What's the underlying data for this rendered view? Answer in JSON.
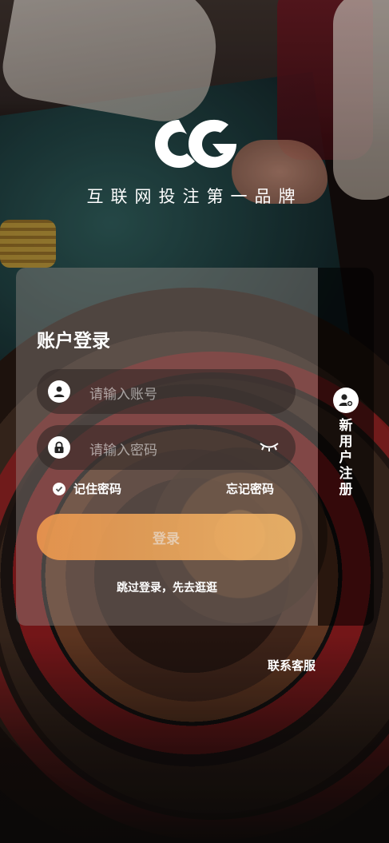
{
  "brand": {
    "logo_text": "CG",
    "tagline": "互联网投注第一品牌"
  },
  "login": {
    "title": "账户登录",
    "username_placeholder": "请输入账号",
    "password_placeholder": "请输入密码",
    "remember_label": "记住密码",
    "forgot_label": "忘记密码",
    "login_button": "登录",
    "skip_link": "跳过登录，先去逛逛"
  },
  "register": {
    "label": "新用户注册"
  },
  "footer": {
    "customer_service": "联系客服"
  },
  "colors": {
    "accent": "#f3a35a",
    "panel": "rgba(150,140,136,0.42)",
    "side": "rgba(0,0,0,0.55)"
  },
  "icons": [
    "user-icon",
    "lock-icon",
    "eye-closed-icon",
    "check-icon",
    "add-user-icon"
  ]
}
